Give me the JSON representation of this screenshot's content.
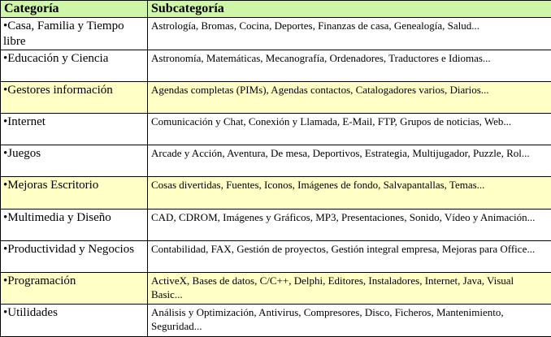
{
  "header": {
    "category": "Categoría",
    "subcategory": "Subcategoría"
  },
  "colors": {
    "header_bg": "#cff5a7",
    "highlight_bg": "#ffffc6",
    "border": "#000000"
  },
  "rows": [
    {
      "category": "•Casa, Familia y Tiempo libre",
      "subcategory": "Astrología, Bromas, Cocina, Deportes, Finanzas de casa, Genealogía, Salud...",
      "highlighted": false
    },
    {
      "category": "•Educación y Ciencia",
      "subcategory": "Astronomía, Matemáticas, Mecanografía, Ordenadores, Traductores e Idiomas...",
      "highlighted": false
    },
    {
      "category": "•Gestores información",
      "subcategory": "Agendas completas (PIMs), Agendas contactos, Catalogadores varios, Diarios...",
      "highlighted": true
    },
    {
      "category": "•Internet",
      "subcategory": "Comunicación y Chat, Conexión y Llamada, E-Mail, FTP, Grupos de noticias, Web...",
      "highlighted": false
    },
    {
      "category": "•Juegos",
      "subcategory": "Arcade y Acción, Aventura, De mesa, Deportivos, Estrategia, Multijugador, Puzzle, Rol...",
      "highlighted": false
    },
    {
      "category": "•Mejoras Escritorio",
      "subcategory": "Cosas divertidas, Fuentes, Iconos, Imágenes de fondo, Salvapantallas, Temas...",
      "highlighted": true
    },
    {
      "category": "•Multimedia y Diseño",
      "subcategory": "CAD, CDROM, Imágenes y Gráficos, MP3, Presentaciones, Sonido, Vídeo y Animación...",
      "highlighted": false
    },
    {
      "category": "•Productividad y Negocios",
      "subcategory": "Contabilidad, FAX, Gestión de proyectos, Gestión integral empresa, Mejoras para Office...",
      "highlighted": false
    },
    {
      "category": "•Programación",
      "subcategory": "ActiveX, Bases de datos, C/C++, Delphi, Editores, Instaladores, Internet, Java, Visual Basic...",
      "highlighted": true
    },
    {
      "category": "•Utilidades",
      "subcategory": "Análisis y Optimización, Antivirus, Compresores, Disco, Ficheros, Mantenimiento, Seguridad...",
      "highlighted": false
    }
  ]
}
